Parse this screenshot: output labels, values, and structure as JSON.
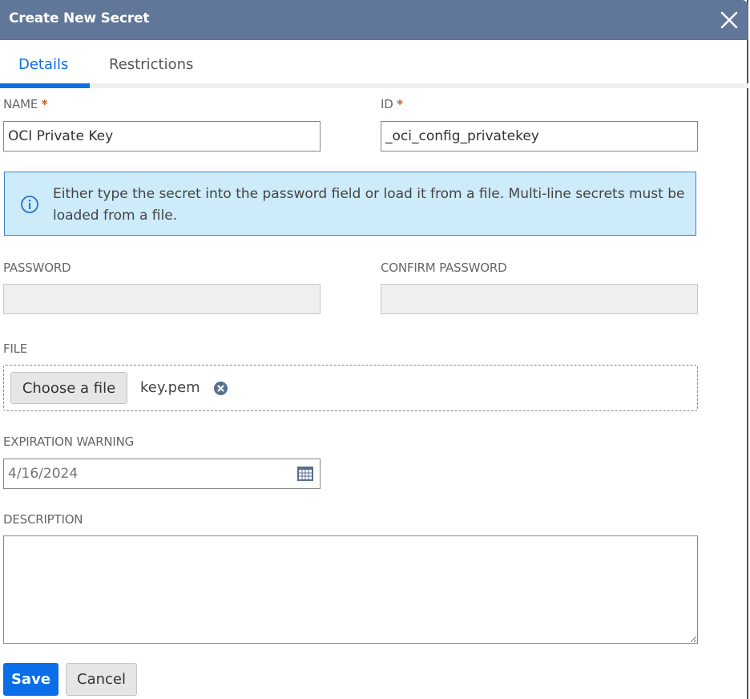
{
  "dialog": {
    "title": "Create New Secret",
    "close_icon": "close-icon"
  },
  "tabs": [
    {
      "label": "Details",
      "active": true
    },
    {
      "label": "Restrictions",
      "active": false
    }
  ],
  "fields": {
    "name": {
      "label": "NAME",
      "required_mark": "*",
      "value": "OCI Private Key"
    },
    "id": {
      "label": "ID",
      "required_mark": "*",
      "value": "_oci_config_privatekey"
    },
    "password": {
      "label": "PASSWORD",
      "value": ""
    },
    "confirm_password": {
      "label": "CONFIRM PASSWORD",
      "value": ""
    },
    "file": {
      "label": "FILE",
      "button_label": "Choose a file",
      "filename": "key.pem"
    },
    "expiration": {
      "label": "EXPIRATION WARNING",
      "placeholder": "4/16/2024"
    },
    "description": {
      "label": "DESCRIPTION",
      "value": ""
    }
  },
  "info": {
    "icon": "info-icon",
    "text": "Either type the secret into the password field or load it from a file. Multi-line secrets must be loaded from a file."
  },
  "actions": {
    "save_label": "Save",
    "cancel_label": "Cancel"
  },
  "colors": {
    "header": "#617799",
    "accent": "#0d6fe6",
    "required": "#c75d1a",
    "info_bg": "#cdebf9"
  }
}
